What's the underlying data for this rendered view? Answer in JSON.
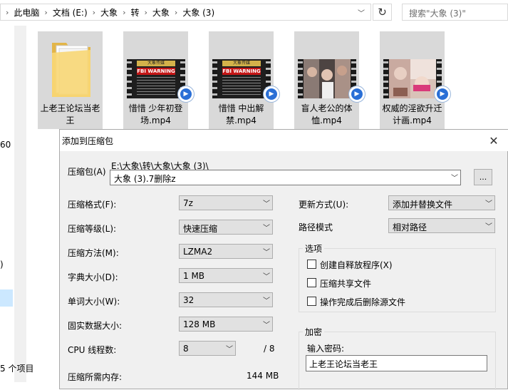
{
  "explorer": {
    "breadcrumb": [
      "此电脑",
      "文档 (E:)",
      "大象",
      "转",
      "大象",
      "大象 (3)"
    ],
    "search_placeholder": "搜索\"大象 (3)\"",
    "side_numbers": [
      "60",
      ")"
    ],
    "status_text": "5 个项目",
    "files": [
      {
        "name": "上老王论坛当老王",
        "type": "folder"
      },
      {
        "name": "惜惜 少年初登场.mp4",
        "type": "video-fbi",
        "banner": "大象传媒",
        "warning": "FBI WARNING"
      },
      {
        "name": "惜惜 中出解禁.mp4",
        "type": "video-fbi",
        "banner": "大象传媒",
        "warning": "FBI WARNING"
      },
      {
        "name": "盲人老公的体恤.mp4",
        "type": "video-photo"
      },
      {
        "name": "权威的淫欲升迁计画.mp4",
        "type": "video-photo"
      }
    ]
  },
  "dialog": {
    "title": "添加到压缩包",
    "archive_label": "压缩包(A)",
    "archive_path": "E:\\大象\\转\\大象\\大象 (3)\\",
    "archive_name": "大象 (3).7删除z",
    "browse_label": "...",
    "format_label": "压缩格式(F):",
    "format_value": "7z",
    "level_label": "压缩等级(L):",
    "level_value": "快速压缩",
    "method_label": "压缩方法(M):",
    "method_value": "LZMA2",
    "dict_label": "字典大小(D):",
    "dict_value": "1 MB",
    "word_label": "单词大小(W):",
    "word_value": "32",
    "solid_label": "固实数据大小:",
    "solid_value": "128 MB",
    "threads_label": "CPU 线程数:",
    "threads_value": "8",
    "threads_total": "/ 8",
    "memory_label": "压缩所需内存:",
    "memory_value": "144 MB",
    "update_label": "更新方式(U):",
    "update_value": "添加并替换文件",
    "path_label": "路径模式",
    "path_value": "相对路径",
    "options_title": "选项",
    "opt_sfx": "创建自释放程序(X)",
    "opt_shared": "压缩共享文件",
    "opt_delete": "操作完成后删除源文件",
    "encrypt_title": "加密",
    "password_label": "输入密码:",
    "password_value": "上老王论坛当老王"
  }
}
